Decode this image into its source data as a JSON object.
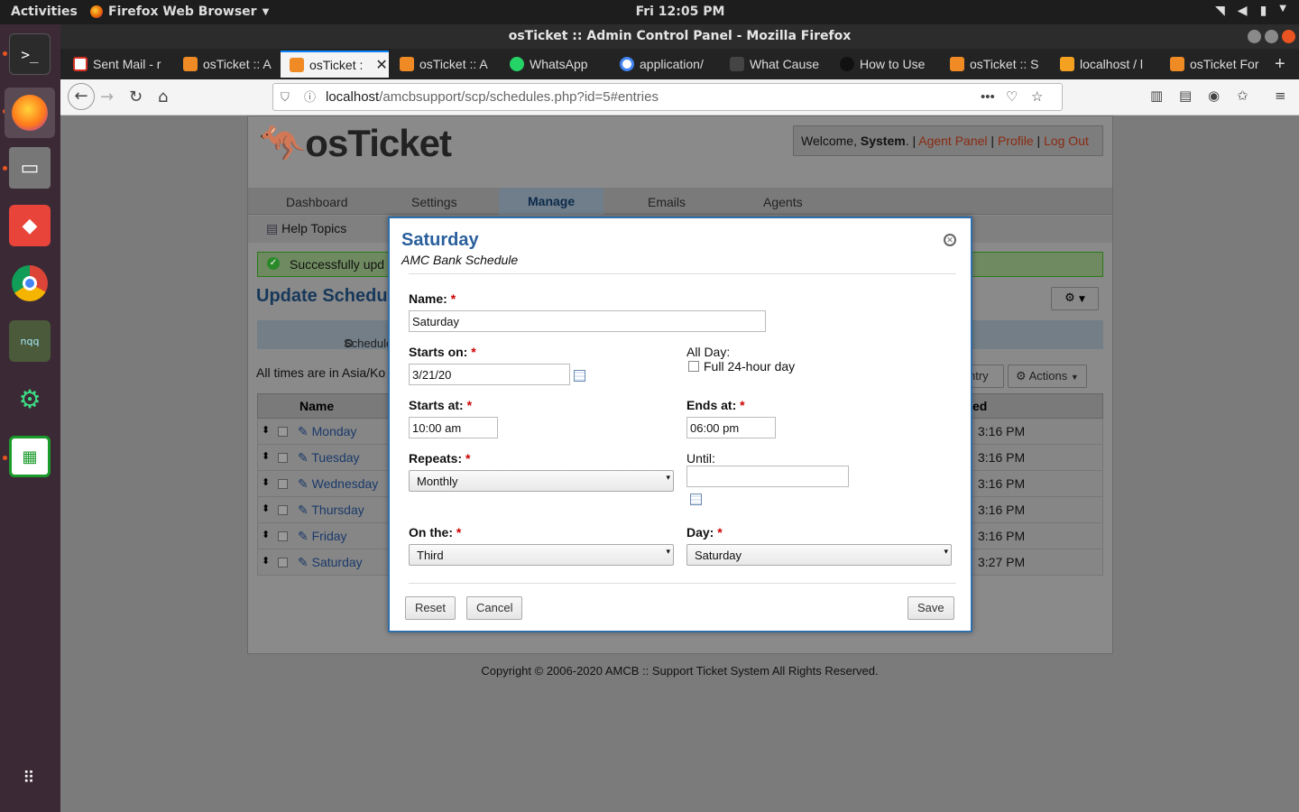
{
  "system": {
    "activities": "Activities",
    "app_name": "Firefox Web Browser",
    "clock": "Fri 12:05 PM"
  },
  "window": {
    "title": "osTicket :: Admin Control Panel - Mozilla Firefox"
  },
  "tabs": [
    {
      "label": "Sent Mail - r"
    },
    {
      "label": "osTicket :: A"
    },
    {
      "label": "osTicket :"
    },
    {
      "label": "osTicket :: A"
    },
    {
      "label": "WhatsApp"
    },
    {
      "label": "application/"
    },
    {
      "label": "What Cause"
    },
    {
      "label": "How to Use"
    },
    {
      "label": "osTicket :: S"
    },
    {
      "label": "localhost / l"
    },
    {
      "label": "osTicket For"
    }
  ],
  "url": {
    "host": "localhost",
    "path": "/amcbsupport/scp/schedules.php?id=5#entries"
  },
  "header": {
    "logo": "osTicket",
    "welcome_prefix": "Welcome, ",
    "user": "System",
    "agent_panel": "Agent Panel",
    "profile": "Profile",
    "logout": "Log Out"
  },
  "nav": {
    "tabs": [
      "Dashboard",
      "Settings",
      "Manage",
      "Emails",
      "Agents"
    ],
    "sub": [
      "Help Topics"
    ]
  },
  "page": {
    "success": "Successfully upd",
    "title": "Update Schedu",
    "schedule_tab": "Schedule",
    "timezone": "All times are in Asia/Ko",
    "entry_btn": "ntry",
    "actions_btn": "Actions",
    "col_name": "Name",
    "col_updated": "ed",
    "rows": [
      {
        "name": "Monday",
        "time": "3:16 PM"
      },
      {
        "name": "Tuesday",
        "time": "3:16 PM"
      },
      {
        "name": "Wednesday",
        "time": "3:16 PM"
      },
      {
        "name": "Thursday",
        "time": "3:16 PM"
      },
      {
        "name": "Friday",
        "time": "3:16 PM"
      },
      {
        "name": "Saturday",
        "time": "3:27 PM"
      }
    ],
    "footer": "Copyright © 2006-2020 AMCB :: Support Ticket System All Rights Reserved."
  },
  "modal": {
    "title": "Saturday",
    "subtitle": "AMC Bank Schedule",
    "name_label": "Name:",
    "name_value": "Saturday",
    "starts_on_label": "Starts on:",
    "starts_on_value": "3/21/20",
    "all_day_label": "All Day:",
    "full_day_label": "Full 24-hour day",
    "starts_at_label": "Starts at:",
    "starts_at_value": "10:00 am",
    "ends_at_label": "Ends at:",
    "ends_at_value": "06:00 pm",
    "repeats_label": "Repeats:",
    "repeats_value": "Monthly",
    "until_label": "Until:",
    "until_value": "",
    "on_the_label": "On the:",
    "on_the_value": "Third",
    "day_label": "Day:",
    "day_value": "Saturday",
    "reset": "Reset",
    "cancel": "Cancel",
    "save": "Save"
  },
  "colors": {
    "modal_border": "#2f6ead",
    "modal_title": "#2a5f9c",
    "required": "#cc0000",
    "dock": "#3b2a35"
  }
}
